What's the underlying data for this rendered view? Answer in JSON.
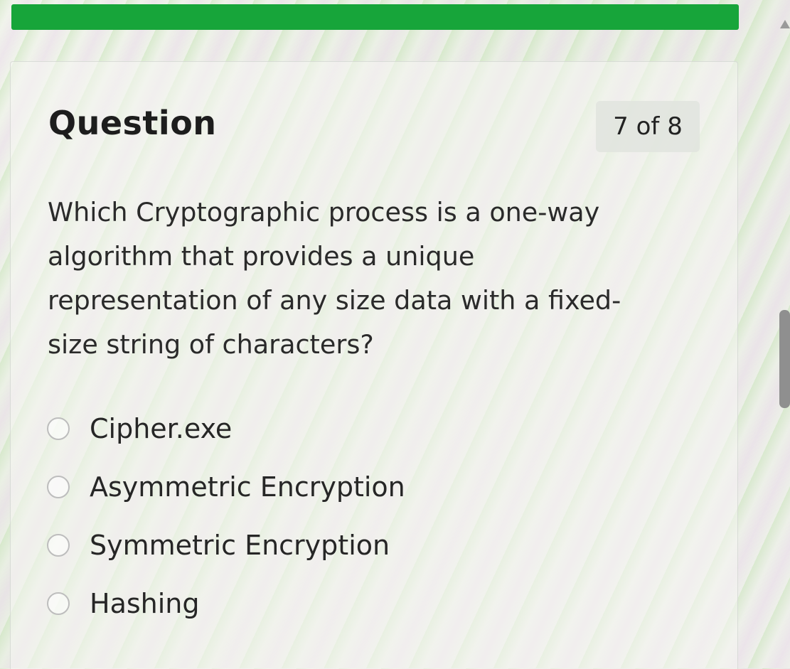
{
  "progress": {
    "fraction": 1.0,
    "color": "#17a53a"
  },
  "header": {
    "title": "Question",
    "counter": "7 of 8"
  },
  "question": {
    "text": "Which Cryptographic process is a one-way\nalgorithm that provides a unique\nrepresentation of any size data with a fixed-\nsize string of characters?"
  },
  "options": [
    {
      "label": "Cipher.exe",
      "selected": false
    },
    {
      "label": "Asymmetric Encryption",
      "selected": false
    },
    {
      "label": "Symmetric Encryption",
      "selected": false
    },
    {
      "label": "Hashing",
      "selected": false
    }
  ],
  "icons": {
    "radio": "radio-button-icon",
    "scroll_up": "chevron-up-icon"
  }
}
